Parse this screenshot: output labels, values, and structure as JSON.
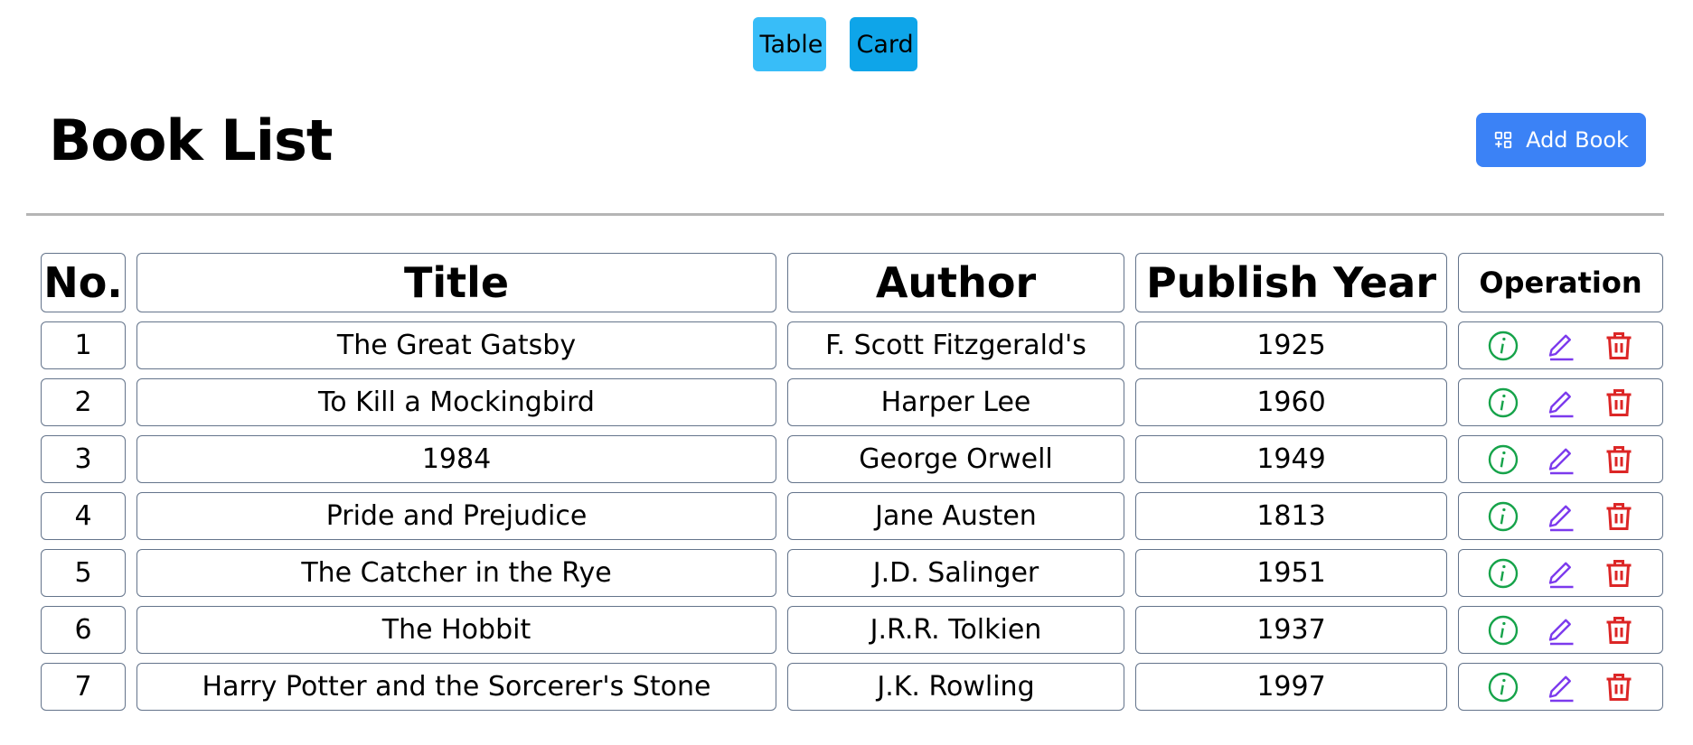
{
  "view_toggle": {
    "table_label": "Table",
    "card_label": "Card"
  },
  "header": {
    "title": "Book List",
    "add_button_label": "Add Book"
  },
  "table": {
    "columns": [
      "No.",
      "Title",
      "Author",
      "Publish Year",
      "Operation"
    ],
    "rows": [
      {
        "no": "1",
        "title": "The Great Gatsby",
        "author": "F. Scott Fitzgerald's",
        "year": "1925"
      },
      {
        "no": "2",
        "title": "To Kill a Mockingbird",
        "author": "Harper Lee",
        "year": "1960"
      },
      {
        "no": "3",
        "title": "1984",
        "author": "George Orwell",
        "year": "1949"
      },
      {
        "no": "4",
        "title": "Pride and Prejudice",
        "author": "Jane Austen",
        "year": "1813"
      },
      {
        "no": "5",
        "title": "The Catcher in the Rye",
        "author": "J.D. Salinger",
        "year": "1951"
      },
      {
        "no": "6",
        "title": "The Hobbit",
        "author": "J.R.R. Tolkien",
        "year": "1937"
      },
      {
        "no": "7",
        "title": "Harry Potter and the Sorcerer's Stone",
        "author": "J.K. Rowling",
        "year": "1997"
      }
    ]
  },
  "icons": {
    "add": "add-grid-icon",
    "info": "info-circle-icon",
    "edit": "pencil-edit-icon",
    "delete": "trash-icon"
  },
  "colors": {
    "table_button": "#38bdf8",
    "card_button": "#0ea5e9",
    "add_button": "#3b82f6",
    "info_icon": "#16a34a",
    "edit_icon": "#7c3aed",
    "delete_icon": "#dc2626",
    "cell_border": "#64748b"
  }
}
